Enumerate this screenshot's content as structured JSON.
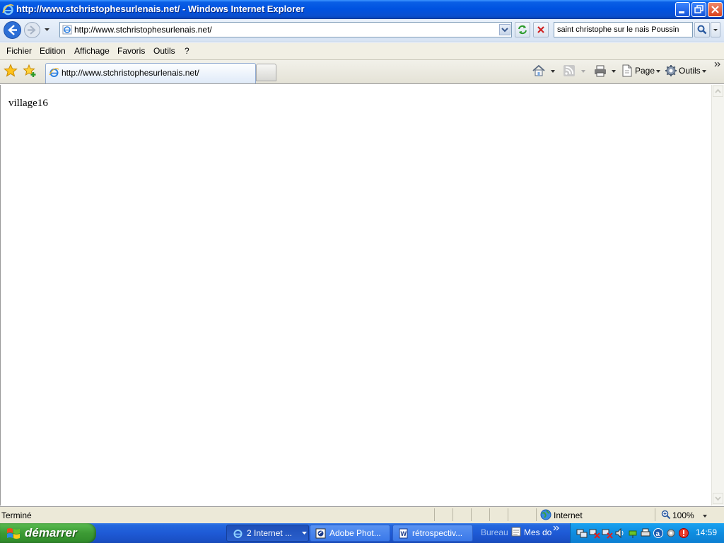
{
  "window": {
    "title": "http://www.stchristophesurlenais.net/ - Windows Internet Explorer"
  },
  "address_bar": {
    "url": "http://www.stchristophesurlenais.net/"
  },
  "search": {
    "value": "saint christophe sur le nais Poussin"
  },
  "menu": {
    "items": [
      "Fichier",
      "Edition",
      "Affichage",
      "Favoris",
      "Outils",
      "?"
    ]
  },
  "tabs": {
    "active_label": "http://www.stchristophesurlenais.net/"
  },
  "command_bar": {
    "page_label": "Page",
    "tools_label": "Outils"
  },
  "content": {
    "text": "village16"
  },
  "status_bar": {
    "status": "Terminé",
    "zone": "Internet",
    "zoom": "100%"
  },
  "taskbar": {
    "start_label": "démarrer",
    "buttons": [
      "2 Internet ...",
      "Adobe Phot...",
      "rétrospectiv..."
    ],
    "quicklinks": [
      "Bureau",
      "Mes do"
    ],
    "clock": "14:59"
  },
  "colors": {
    "xp_blue": "#0052e0",
    "start_green": "#3c9a34",
    "tray_blue": "#0f8de0"
  }
}
